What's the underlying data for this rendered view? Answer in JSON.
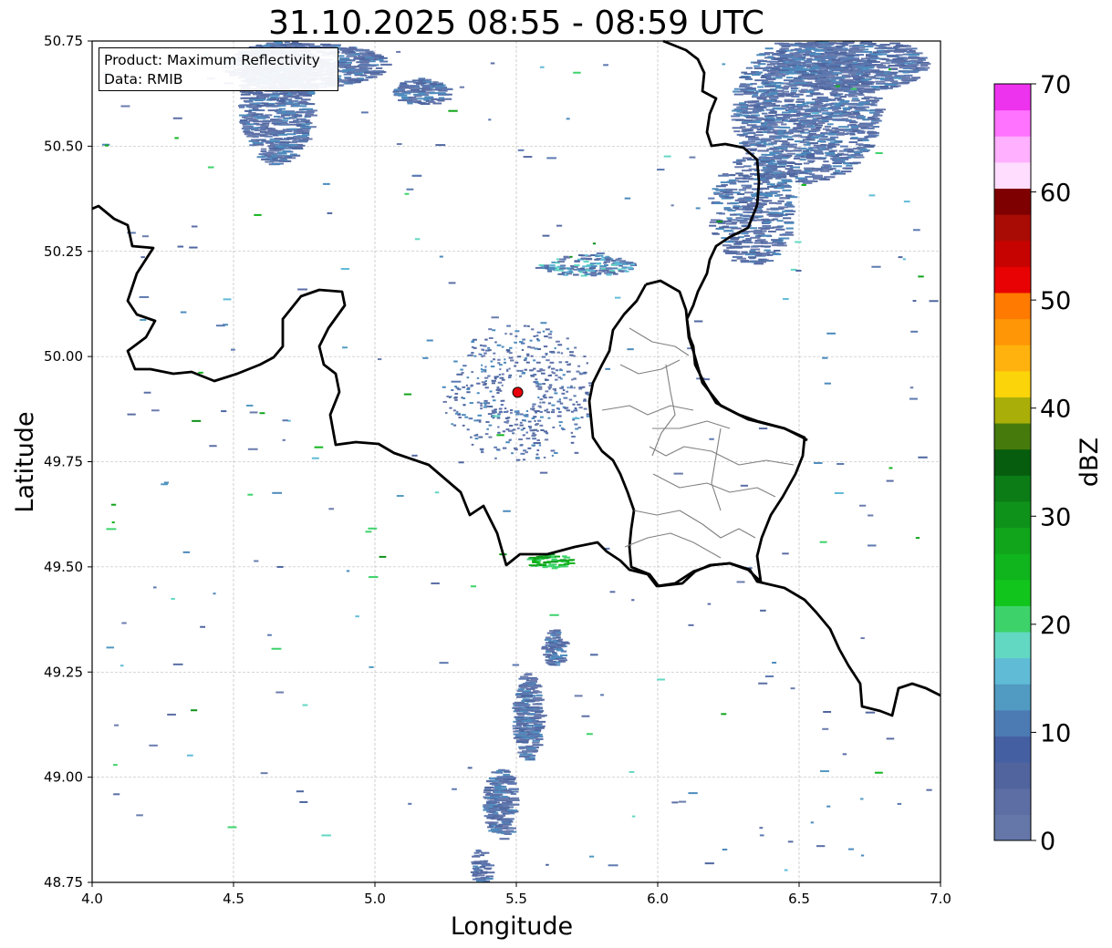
{
  "title": "31.10.2025 08:55 - 08:59 UTC",
  "info": {
    "product": "Product: Maximum Reflectivity",
    "data": "Data: RMIB"
  },
  "map": {
    "xlabel": "Longitude",
    "ylabel": "Latitude",
    "xlim": [
      4.0,
      7.0
    ],
    "ylim": [
      48.75,
      50.75
    ],
    "xticks": [
      "4.0",
      "4.5",
      "5.0",
      "5.5",
      "6.0",
      "6.5",
      "7.0"
    ],
    "yticks": [
      "48.75",
      "49.00",
      "49.25",
      "49.50",
      "49.75",
      "50.00",
      "50.25",
      "50.50",
      "50.75"
    ],
    "grid": true,
    "radar_site": {
      "lon": 5.505,
      "lat": 49.915,
      "color": "#e8000b"
    },
    "borders": {
      "color_country": "#000000",
      "color_district": "#808080"
    }
  },
  "colorbar": {
    "label": "dBZ",
    "min": 0,
    "max": 70,
    "ticks": [
      "0",
      "10",
      "20",
      "30",
      "40",
      "50",
      "60",
      "70"
    ],
    "colors": [
      "#6577a8",
      "#5c6ea4",
      "#51649e",
      "#4560a2",
      "#4c7ab3",
      "#519ac1",
      "#60bbd7",
      "#62d8c3",
      "#3dd36a",
      "#12c51c",
      "#10b41c",
      "#10a51a",
      "#0e921a",
      "#0b7c16",
      "#075d0e",
      "#467a0c",
      "#a9af08",
      "#fbd40a",
      "#ffb20d",
      "#ff9606",
      "#ff7a00",
      "#e80203",
      "#c60301",
      "#a90c05",
      "#7e0000",
      "#ffddff",
      "#ffb0ff",
      "#ff73ff",
      "#ee33ee"
    ]
  }
}
